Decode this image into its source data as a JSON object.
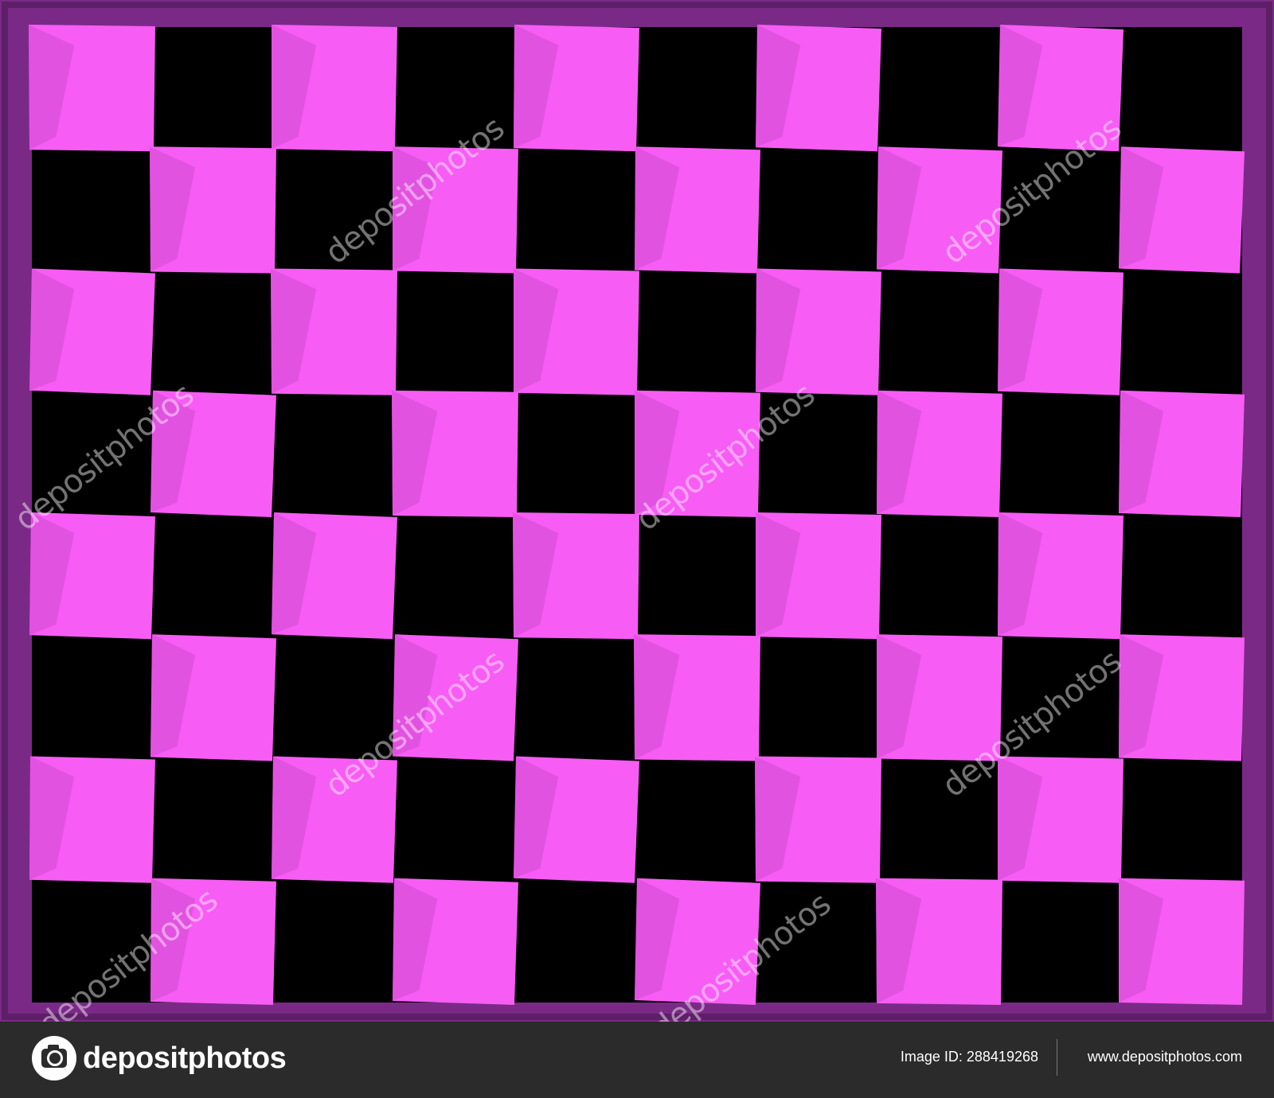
{
  "image": {
    "subject": "checkerboard",
    "columns": 10,
    "rows": 8,
    "colors": {
      "frame": "#7a2a86",
      "light_square": "#f75cf4",
      "dark_square": "#000000",
      "light_shade": "#d24bd0",
      "footer": "#2b2b2b"
    }
  },
  "watermark": {
    "text": "depositphotos"
  },
  "footer": {
    "logo_icon": "camera-icon",
    "logo_text": "depositphotos",
    "image_id": "Image ID: 288419268",
    "site_url": "www.depositphotos.com"
  }
}
